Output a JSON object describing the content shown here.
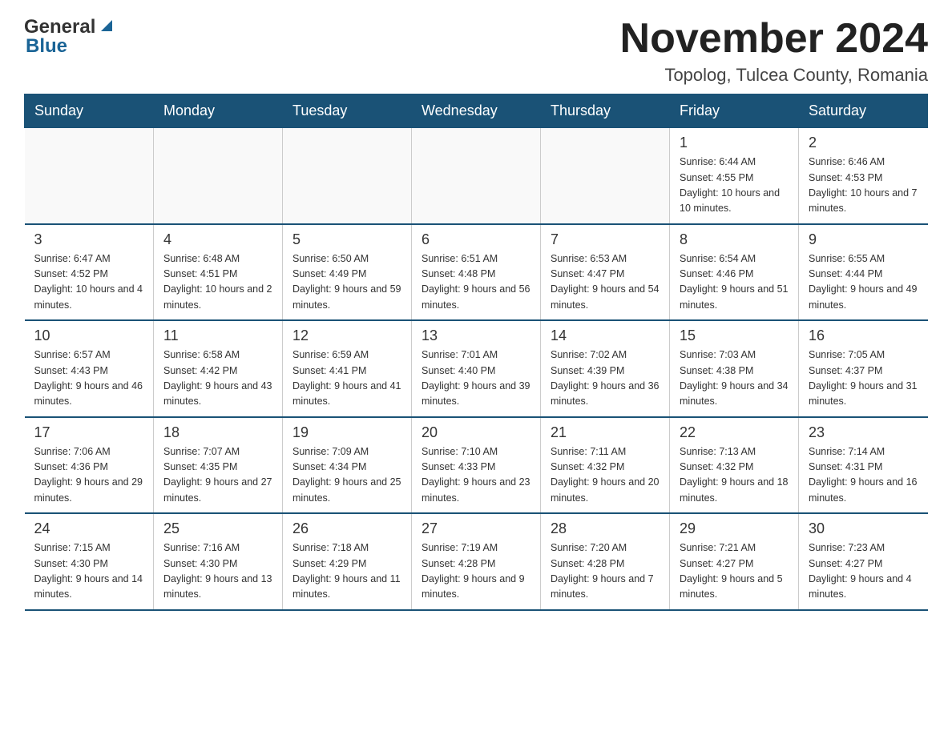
{
  "header": {
    "logo_general": "General",
    "logo_blue": "Blue",
    "title": "November 2024",
    "subtitle": "Topolog, Tulcea County, Romania"
  },
  "weekdays": [
    "Sunday",
    "Monday",
    "Tuesday",
    "Wednesday",
    "Thursday",
    "Friday",
    "Saturday"
  ],
  "weeks": [
    [
      {
        "day": "",
        "info": ""
      },
      {
        "day": "",
        "info": ""
      },
      {
        "day": "",
        "info": ""
      },
      {
        "day": "",
        "info": ""
      },
      {
        "day": "",
        "info": ""
      },
      {
        "day": "1",
        "info": "Sunrise: 6:44 AM\nSunset: 4:55 PM\nDaylight: 10 hours\nand 10 minutes."
      },
      {
        "day": "2",
        "info": "Sunrise: 6:46 AM\nSunset: 4:53 PM\nDaylight: 10 hours\nand 7 minutes."
      }
    ],
    [
      {
        "day": "3",
        "info": "Sunrise: 6:47 AM\nSunset: 4:52 PM\nDaylight: 10 hours\nand 4 minutes."
      },
      {
        "day": "4",
        "info": "Sunrise: 6:48 AM\nSunset: 4:51 PM\nDaylight: 10 hours\nand 2 minutes."
      },
      {
        "day": "5",
        "info": "Sunrise: 6:50 AM\nSunset: 4:49 PM\nDaylight: 9 hours\nand 59 minutes."
      },
      {
        "day": "6",
        "info": "Sunrise: 6:51 AM\nSunset: 4:48 PM\nDaylight: 9 hours\nand 56 minutes."
      },
      {
        "day": "7",
        "info": "Sunrise: 6:53 AM\nSunset: 4:47 PM\nDaylight: 9 hours\nand 54 minutes."
      },
      {
        "day": "8",
        "info": "Sunrise: 6:54 AM\nSunset: 4:46 PM\nDaylight: 9 hours\nand 51 minutes."
      },
      {
        "day": "9",
        "info": "Sunrise: 6:55 AM\nSunset: 4:44 PM\nDaylight: 9 hours\nand 49 minutes."
      }
    ],
    [
      {
        "day": "10",
        "info": "Sunrise: 6:57 AM\nSunset: 4:43 PM\nDaylight: 9 hours\nand 46 minutes."
      },
      {
        "day": "11",
        "info": "Sunrise: 6:58 AM\nSunset: 4:42 PM\nDaylight: 9 hours\nand 43 minutes."
      },
      {
        "day": "12",
        "info": "Sunrise: 6:59 AM\nSunset: 4:41 PM\nDaylight: 9 hours\nand 41 minutes."
      },
      {
        "day": "13",
        "info": "Sunrise: 7:01 AM\nSunset: 4:40 PM\nDaylight: 9 hours\nand 39 minutes."
      },
      {
        "day": "14",
        "info": "Sunrise: 7:02 AM\nSunset: 4:39 PM\nDaylight: 9 hours\nand 36 minutes."
      },
      {
        "day": "15",
        "info": "Sunrise: 7:03 AM\nSunset: 4:38 PM\nDaylight: 9 hours\nand 34 minutes."
      },
      {
        "day": "16",
        "info": "Sunrise: 7:05 AM\nSunset: 4:37 PM\nDaylight: 9 hours\nand 31 minutes."
      }
    ],
    [
      {
        "day": "17",
        "info": "Sunrise: 7:06 AM\nSunset: 4:36 PM\nDaylight: 9 hours\nand 29 minutes."
      },
      {
        "day": "18",
        "info": "Sunrise: 7:07 AM\nSunset: 4:35 PM\nDaylight: 9 hours\nand 27 minutes."
      },
      {
        "day": "19",
        "info": "Sunrise: 7:09 AM\nSunset: 4:34 PM\nDaylight: 9 hours\nand 25 minutes."
      },
      {
        "day": "20",
        "info": "Sunrise: 7:10 AM\nSunset: 4:33 PM\nDaylight: 9 hours\nand 23 minutes."
      },
      {
        "day": "21",
        "info": "Sunrise: 7:11 AM\nSunset: 4:32 PM\nDaylight: 9 hours\nand 20 minutes."
      },
      {
        "day": "22",
        "info": "Sunrise: 7:13 AM\nSunset: 4:32 PM\nDaylight: 9 hours\nand 18 minutes."
      },
      {
        "day": "23",
        "info": "Sunrise: 7:14 AM\nSunset: 4:31 PM\nDaylight: 9 hours\nand 16 minutes."
      }
    ],
    [
      {
        "day": "24",
        "info": "Sunrise: 7:15 AM\nSunset: 4:30 PM\nDaylight: 9 hours\nand 14 minutes."
      },
      {
        "day": "25",
        "info": "Sunrise: 7:16 AM\nSunset: 4:30 PM\nDaylight: 9 hours\nand 13 minutes."
      },
      {
        "day": "26",
        "info": "Sunrise: 7:18 AM\nSunset: 4:29 PM\nDaylight: 9 hours\nand 11 minutes."
      },
      {
        "day": "27",
        "info": "Sunrise: 7:19 AM\nSunset: 4:28 PM\nDaylight: 9 hours\nand 9 minutes."
      },
      {
        "day": "28",
        "info": "Sunrise: 7:20 AM\nSunset: 4:28 PM\nDaylight: 9 hours\nand 7 minutes."
      },
      {
        "day": "29",
        "info": "Sunrise: 7:21 AM\nSunset: 4:27 PM\nDaylight: 9 hours\nand 5 minutes."
      },
      {
        "day": "30",
        "info": "Sunrise: 7:23 AM\nSunset: 4:27 PM\nDaylight: 9 hours\nand 4 minutes."
      }
    ]
  ]
}
